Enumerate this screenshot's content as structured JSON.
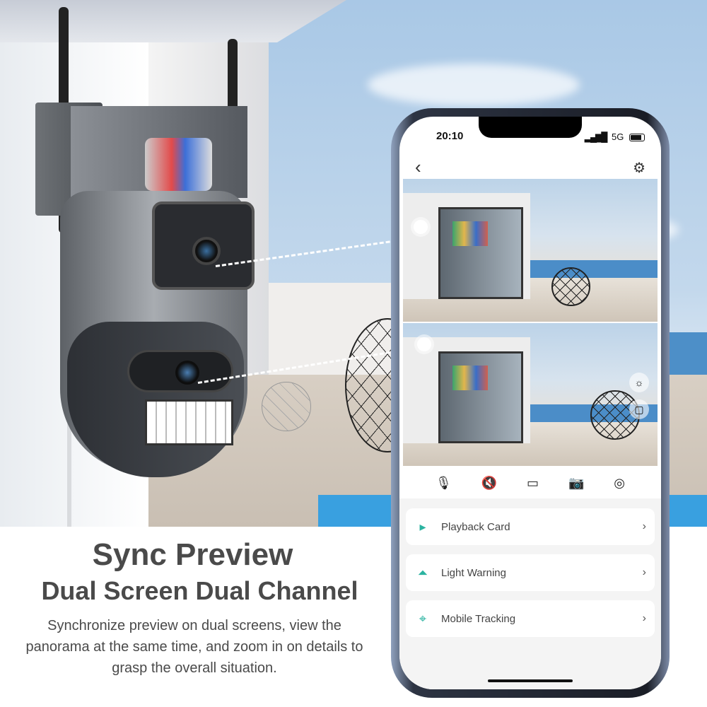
{
  "headline": {
    "title": "Sync Preview",
    "subtitle": "Dual Screen Dual Channel",
    "description": "Synchronize preview on dual screens, view the panorama at the same time, and zoom in on details to grasp the overall situation."
  },
  "phone": {
    "status": {
      "time": "20:10",
      "network": "5G",
      "signal_icon": "signal-bars-icon",
      "battery_icon": "battery-icon"
    },
    "nav": {
      "back_icon": "chevron-left-icon",
      "settings_icon": "gear-icon"
    },
    "controls": [
      {
        "icon": "microphone-icon",
        "glyph": "🎙"
      },
      {
        "icon": "speaker-mute-icon",
        "glyph": "🔇"
      },
      {
        "icon": "video-record-icon",
        "glyph": "▭"
      },
      {
        "icon": "camera-snapshot-icon",
        "glyph": "📷"
      },
      {
        "icon": "ptz-control-icon",
        "glyph": "◎"
      }
    ],
    "menu": [
      {
        "label": "Playback Card",
        "icon": "playback-card-icon",
        "glyph": "▸"
      },
      {
        "label": "Light Warning",
        "icon": "alarm-light-icon",
        "glyph": "⏶"
      },
      {
        "label": "Mobile Tracking",
        "icon": "crosshair-icon",
        "glyph": "⌖"
      }
    ],
    "chevron": "›",
    "accent_color": "#2bb3a0"
  }
}
